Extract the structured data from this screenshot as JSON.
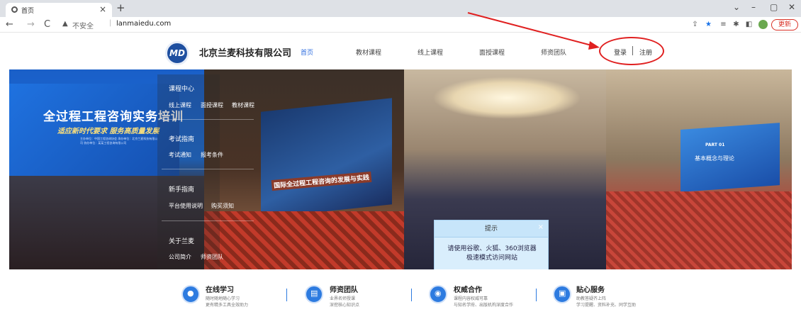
{
  "browser": {
    "tab_title": "首页",
    "tab_close": "×",
    "new_tab": "+",
    "nav_back": "←",
    "nav_forward": "→",
    "nav_reload": "C",
    "security_label": "不安全",
    "url": "lanmaiedu.com",
    "update_label": "更新",
    "window": {
      "minimize": "–",
      "restore": "▢",
      "close": "✕",
      "chevron": "⌄"
    }
  },
  "site": {
    "company_name": "北京兰麦科技有限公司",
    "menu": [
      "首页",
      "教材课程",
      "线上课程",
      "面授课程",
      "师资团队"
    ],
    "auth": {
      "login": "登录",
      "register": "注册"
    }
  },
  "banner": {
    "slide1_title": "全过程工程咨询实务培训",
    "slide1_slogan": "适应新时代要求  服务高质量发展",
    "slide1_small": "主办单位：中国工程咨询协会 承办单位：北京兰麦科技有限公司 协办单位：某某工程咨询有限公司",
    "slide2_banner": "国际全过程工程咨询的发展与实践",
    "slide4_part": "PART 01",
    "slide4_subtitle": "基本概念与理论"
  },
  "dropdown": {
    "groups": [
      {
        "title": "课程中心",
        "items": [
          "线上课程",
          "面授课程",
          "教材课程"
        ]
      },
      {
        "title": "考试指南",
        "items": [
          "考试通知",
          "报考条件"
        ]
      },
      {
        "title": "新手指南",
        "items": [
          "平台使用说明",
          "购买须知"
        ]
      },
      {
        "title": "关于兰麦",
        "items": [
          "公司简介",
          "师资团队"
        ]
      }
    ]
  },
  "prompt": {
    "title": "提示",
    "close": "×",
    "message": "请使用谷歌、火狐、360浏览器极速模式访问网站"
  },
  "features": [
    {
      "title": "在线学习",
      "desc1": "随时随地随心学习",
      "desc2": "更有精多工具全效助力",
      "icon": "user-icon"
    },
    {
      "title": "师资团队",
      "desc1": "业界名师授课",
      "desc2": "深挖核心知识点",
      "icon": "document-icon"
    },
    {
      "title": "权威合作",
      "desc1": "课程内容权威可靠",
      "desc2": "与知名学府、出版机构深度合作",
      "icon": "partner-icon"
    },
    {
      "title": "贴心服务",
      "desc1": "助教答疑齐上阵",
      "desc2": "学习提醒、资料补充、同学互助",
      "icon": "service-icon"
    }
  ],
  "colors": {
    "accent": "#2d7be0",
    "annotation": "#e02020"
  }
}
